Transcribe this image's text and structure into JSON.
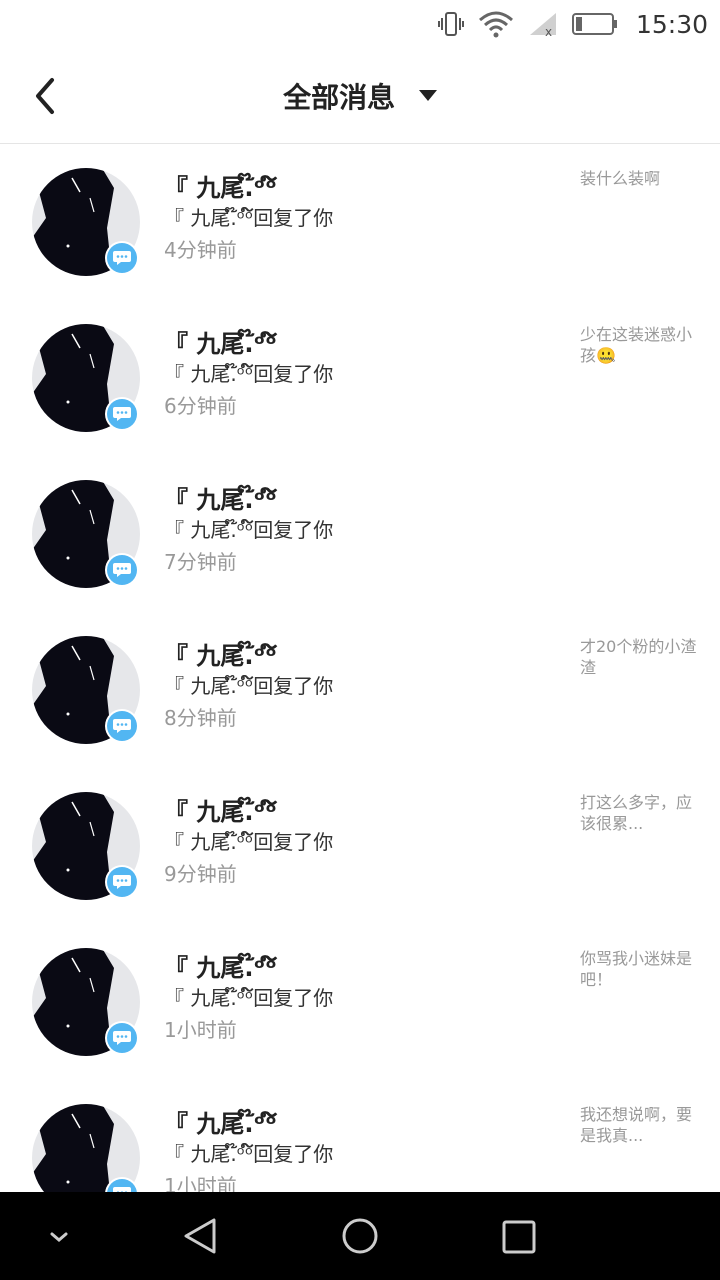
{
  "status_bar": {
    "time": "15:30",
    "icons": [
      "vibrate-icon",
      "wifi-icon",
      "signal-icon",
      "battery-icon"
    ]
  },
  "header": {
    "title": "全部消息",
    "back_icon": "chevron-left-icon",
    "dropdown_icon": "caret-down-icon"
  },
  "messages": [
    {
      "name": "『 ​​九尾.​໊ᵒᵒ໌໌",
      "action": "『 ​​九尾.​໊ᵒᵒ໌໌回复了你",
      "time": "4分钟前",
      "preview": "装什么装啊"
    },
    {
      "name": "『 ​​九尾.​໊ᵒᵒ໌໌",
      "action": "『 ​​九尾.​໊ᵒᵒ໌໌回复了你",
      "time": "6分钟前",
      "preview": "少在这装迷惑小孩🤐"
    },
    {
      "name": "『 ​​九尾.​໊ᵒᵒ໌໌",
      "action": "『 ​​九尾.​໊ᵒᵒ໌໌回复了你",
      "time": "7分钟前",
      "preview": "​​​"
    },
    {
      "name": "『 ​​九尾.​໊ᵒᵒ໌໌",
      "action": "『 ​​九尾.​໊ᵒᵒ໌໌回复了你",
      "time": "8分钟前",
      "preview": "才20个粉的小渣渣"
    },
    {
      "name": "『 ​​九尾.​໊ᵒᵒ໌໌",
      "action": "『 ​​九尾.​໊ᵒᵒ໌໌回复了你",
      "time": "9分钟前",
      "preview": "打这么多字，应该很累..."
    },
    {
      "name": "『 ​​九尾.​໊ᵒᵒ໌໌",
      "action": "『 ​​九尾.​໊ᵒᵒ໌໌回复了你",
      "time": "1小时前",
      "preview": "你骂我小迷妹是吧！"
    },
    {
      "name": "『 ​​九尾.​໊ᵒᵒ໌໌",
      "action": "『 ​​九尾.​໊ᵒᵒ໌໌回复了你",
      "time": "1小时前",
      "preview": "我还想说啊，要是我真..."
    }
  ],
  "nav_bar": {
    "icons": [
      "chevron-down-icon",
      "back-triangle-icon",
      "home-circle-icon",
      "recents-square-icon"
    ]
  },
  "colors": {
    "badge": "#52b6f2",
    "muted_text": "#999999",
    "nav_bg": "#000000"
  }
}
